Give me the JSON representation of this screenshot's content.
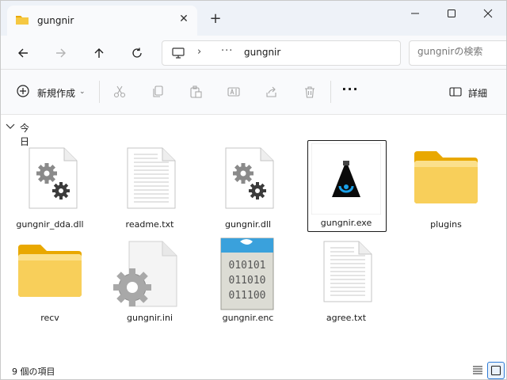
{
  "tab": {
    "title": "gungnir",
    "close_glyph": "✕",
    "new_glyph": "+"
  },
  "address": {
    "more_glyph": "···",
    "separator_glyph": "›",
    "crumb": "gungnir"
  },
  "search": {
    "placeholder": "gungnirの検索"
  },
  "toolbar": {
    "new_label": "新規作成",
    "new_chevron": "⌄",
    "more_glyph": "···",
    "details_label": "詳細"
  },
  "group": {
    "label": "今日"
  },
  "files": [
    {
      "name": "gungnir_dda.dll",
      "type": "dll"
    },
    {
      "name": "readme.txt",
      "type": "txt"
    },
    {
      "name": "gungnir.dll",
      "type": "dll"
    },
    {
      "name": "gungnir.exe",
      "type": "exe",
      "selected": true
    },
    {
      "name": "plugins",
      "type": "folder"
    },
    {
      "name": "recv",
      "type": "folder"
    },
    {
      "name": "gungnir.ini",
      "type": "ini"
    },
    {
      "name": "gungnir.enc",
      "type": "enc",
      "binary_lines": [
        "010101",
        "011010",
        "011100"
      ]
    },
    {
      "name": "agree.txt",
      "type": "txt"
    }
  ],
  "status": {
    "count_label": "9 個の項目"
  },
  "colors": {
    "accent": "#2e7bd6",
    "folder": "#f5c842",
    "folder_back": "#e9a800"
  }
}
